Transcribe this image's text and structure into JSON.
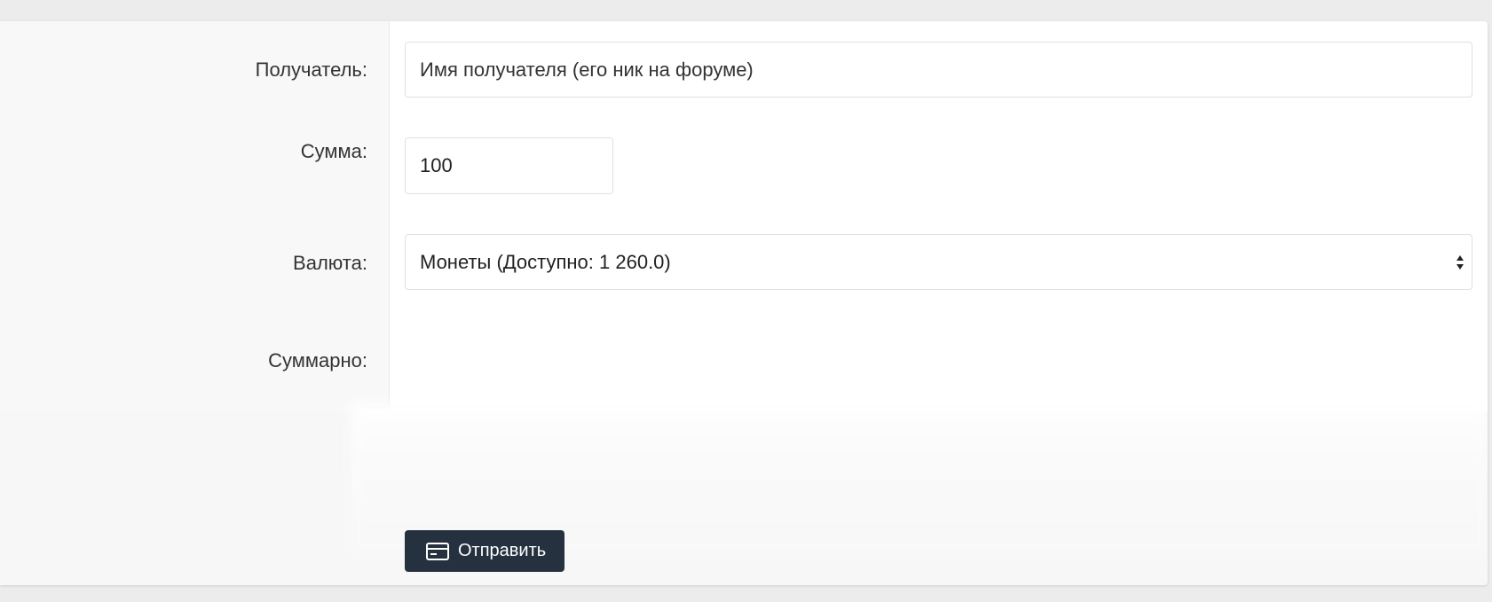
{
  "form": {
    "recipient_label": "Получатель:",
    "recipient_placeholder": "Имя получателя (его ник на форуме)",
    "amount_label": "Сумма:",
    "amount_value": "100",
    "currency_label": "Валюта:",
    "currency_selected": "Монеты (Доступно: 1 260.0)",
    "total_label": "Суммарно:",
    "submit_label": "Отправить"
  },
  "icons": {
    "submit": "credit-card-icon",
    "select": "select-arrows-icon"
  },
  "colors": {
    "button_bg": "#263140",
    "button_text": "#ffffff",
    "label_text": "#333333"
  }
}
